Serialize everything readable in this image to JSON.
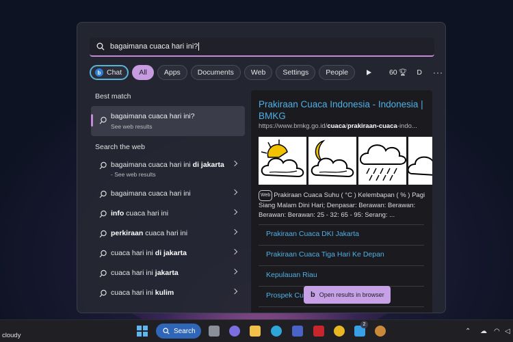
{
  "search": {
    "query": "bagaimana cuaca hari ini?"
  },
  "filters": {
    "chat": "Chat",
    "all": "All",
    "apps": "Apps",
    "documents": "Documents",
    "web": "Web",
    "settings": "Settings",
    "people": "People",
    "points": "60",
    "user_initial": "D",
    "more": "···"
  },
  "left": {
    "best_match_title": "Best match",
    "best_match": {
      "title": "bagaimana cuaca hari ini?",
      "subtitle": "See web results"
    },
    "search_web_title": "Search the web",
    "rows": [
      {
        "pre": "bagaimana cuaca hari ini ",
        "bold": "di jakarta",
        "post": "",
        "sub": "- See web results"
      },
      {
        "pre": "bagaimana cuaca hari ini",
        "bold": "",
        "post": "",
        "sub": ""
      },
      {
        "pre": "",
        "bold": "info",
        "post": " cuaca hari ini",
        "sub": ""
      },
      {
        "pre": "",
        "bold": "perkiraan",
        "post": " cuaca hari ini",
        "sub": ""
      },
      {
        "pre": "cuaca hari ini ",
        "bold": "di jakarta",
        "post": "",
        "sub": ""
      },
      {
        "pre": "cuaca hari ini ",
        "bold": "jakarta",
        "post": "",
        "sub": ""
      },
      {
        "pre": "cuaca hari ini ",
        "bold": "kulim",
        "post": "",
        "sub": ""
      }
    ]
  },
  "right": {
    "title": "Prakiraan Cuaca Indonesia - Indonesia | BMKG",
    "url_pre": "https://www.bmkg.go.id/",
    "url_bold1": "cuaca",
    "url_mid": "/",
    "url_bold2": "prakiraan-cuaca",
    "url_post": "-indo...",
    "web_tag": "Web",
    "snippet": "Prakiraan Cuaca Suhu ( °C ) Kelembapan ( % ) Pagi Siang Malam Dini Hari; Denpasar: Berawan: Berawan: Berawan: Berawan: 25 - 32: 65 - 95: Serang: ...",
    "links": [
      "Prakiraan Cuaca DKI Jakarta",
      "Prakiraan Cuaca Tiga Hari Ke Depan",
      "Kepulauan Riau",
      "Prospek Cu"
    ]
  },
  "open_button": "Open results in browser",
  "taskbar": {
    "weather": "cloudy",
    "search": "Search",
    "badge": "2"
  },
  "colors": {
    "accent": "#c58ad8",
    "link": "#4fb0e6",
    "all_pill": "#c79be0",
    "taskbar_search": "#2f66b8"
  }
}
